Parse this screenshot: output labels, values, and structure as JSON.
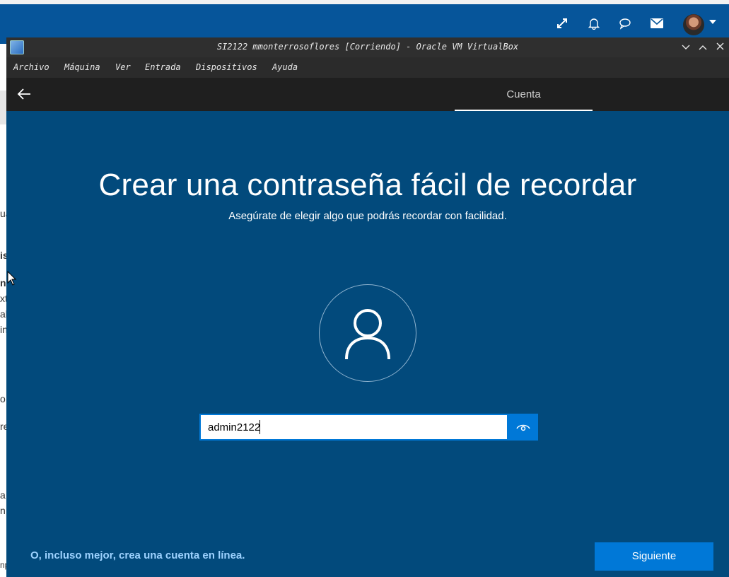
{
  "host": {
    "icons": [
      "expand-icon",
      "bell-icon",
      "chat-bubble-icon",
      "mail-icon"
    ],
    "left_text": [
      "ua",
      "is",
      "n",
      "xtu",
      "al",
      "in",
      "o",
      "re",
      "a",
      "n",
      "np"
    ]
  },
  "vm_window": {
    "title": "SI2122 mmonterrosoflores [Corriendo] - Oracle VM VirtualBox",
    "menu": [
      "Archivo",
      "Máquina",
      "Ver",
      "Entrada",
      "Dispositivos",
      "Ayuda"
    ]
  },
  "oobe": {
    "tab": "Cuenta",
    "title": "Crear una contraseña fácil de recordar",
    "subtitle": "Asegúrate de elegir algo que podrás recordar con facilidad.",
    "password_value": "admin2122",
    "online_link": "O, incluso mejor, crea una cuenta en línea.",
    "next_button": "Siguiente"
  },
  "colors": {
    "host_bar": "#06559a",
    "oobe_background": "#024a7c",
    "accent": "#0078d7",
    "link": "#9dd2ff"
  }
}
